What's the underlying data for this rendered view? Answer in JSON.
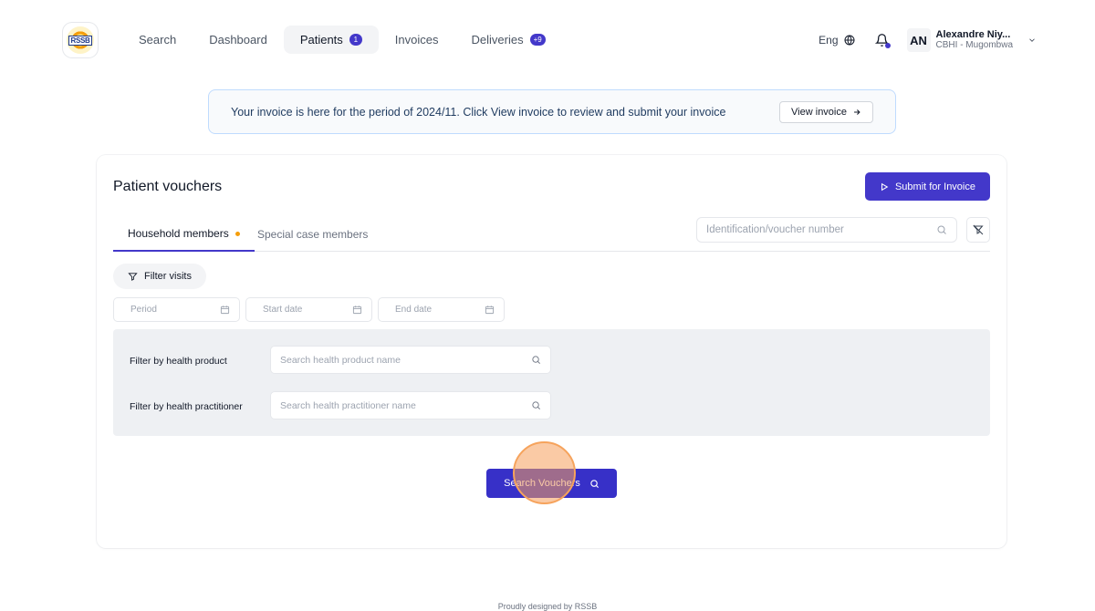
{
  "logo": {
    "text": "RSSB"
  },
  "nav": {
    "items": [
      {
        "label": "Search"
      },
      {
        "label": "Dashboard"
      },
      {
        "label": "Patients",
        "badge": "1"
      },
      {
        "label": "Invoices"
      },
      {
        "label": "Deliveries",
        "badge": "+9"
      }
    ],
    "active": "Patients"
  },
  "header": {
    "language": "Eng",
    "avatar_initials": "AN",
    "user_name": "Alexandre Niy...",
    "user_org": "CBHI - Mugombwa"
  },
  "banner": {
    "text": "Your invoice is here for the period of 2024/11. Click View invoice to review and submit your invoice",
    "button": "View invoice"
  },
  "card": {
    "title": "Patient vouchers",
    "submit_button": "Submit for Invoice",
    "tabs": [
      {
        "label": "Household members",
        "active": true
      },
      {
        "label": "Special case members",
        "active": false
      }
    ],
    "id_search_placeholder": "Identification/voucher number",
    "filter_visits_label": "Filter visits",
    "dates": {
      "period_placeholder": "Period",
      "start_placeholder": "Start date",
      "end_placeholder": "End date"
    },
    "filters": {
      "product_label": "Filter by health product",
      "product_placeholder": "Search health product name",
      "practitioner_label": "Filter by health practitioner",
      "practitioner_placeholder": "Search health practitioner name"
    },
    "search_button": "Search Vouchers"
  },
  "footer": {
    "text": "Proudly designed by RSSB"
  },
  "colors": {
    "primary": "#4338ca",
    "accent_dot": "#f59e0b",
    "banner_border": "#bfdbfe"
  }
}
